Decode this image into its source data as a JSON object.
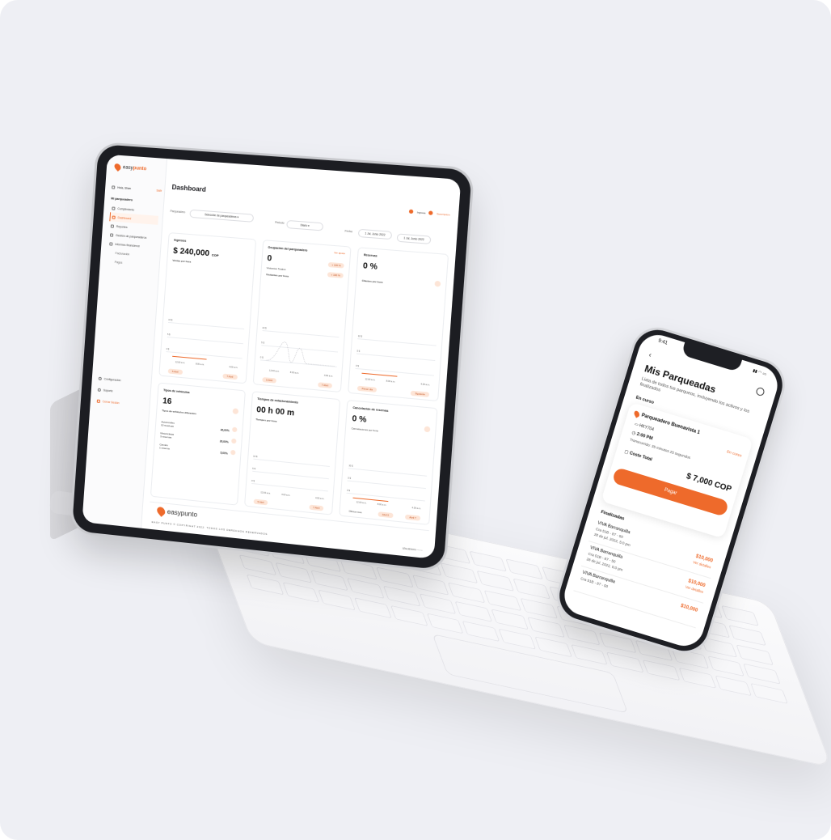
{
  "brand": {
    "name_prefix": "easy",
    "name_suffix": "punto",
    "accent": "#ee6a2b",
    "accent_soft": "#fde5d7"
  },
  "dashboard": {
    "title": "Dashboard",
    "user": {
      "greeting": "Hola, Shan",
      "logout_short": "Salir"
    },
    "sidebar": {
      "section": "Mi parqueadero",
      "items": [
        {
          "label": "Cumplimiento",
          "icon": "checklist-icon"
        },
        {
          "label": "Dashboard",
          "icon": "dashboard-icon"
        },
        {
          "label": "Reportes",
          "icon": "report-icon"
        },
        {
          "label": "Gestión de parqueaderos",
          "icon": "parking-icon"
        },
        {
          "label": "Informes financieros",
          "icon": "finance-icon"
        },
        {
          "label": "Facturación",
          "icon": ""
        },
        {
          "label": "Pagos",
          "icon": ""
        }
      ],
      "bottom": [
        {
          "label": "Configuración",
          "icon": "gear-icon"
        },
        {
          "label": "Soporte",
          "icon": "support-icon"
        },
        {
          "label": "Cerrar Sesión",
          "icon": "logout-icon"
        }
      ]
    },
    "topbar": {
      "account_label": "Ingresa",
      "account_value": "Suscripción"
    },
    "filters": {
      "parking_label": "Parqueadero",
      "parking_value": "Selección de parqueaderos",
      "period_label": "Periodo",
      "period_value": "Diario",
      "date_label": "Fecha",
      "date_from": "1 Jul, Junio 2022",
      "date_to": "1 Jul, Junio 2022"
    },
    "cards": [
      {
        "title": "Ingresos",
        "value": "$ 240,000",
        "unit": "COP",
        "subtitle": "Ventas por hora",
        "y_ticks": [
          "10 $",
          "5 $",
          "0 $"
        ],
        "x_ticks": [
          "12:00 a.m.",
          "8:00 a.m.",
          "4:00 a.m."
        ],
        "dates": [
          "5 Abril",
          "7 Abril"
        ]
      },
      {
        "title": "Ocupación del parqueadero",
        "value": "0",
        "link": "Ver ajuste",
        "rows": [
          "Visitantes Totales",
          "Visitantes por hora"
        ],
        "pills": [
          "+ 100 %",
          "+ 100 %"
        ],
        "y_ticks": [
          "10 $",
          "5 $",
          "0 $"
        ],
        "x_ticks": [
          "12:00 a.m.",
          "8:00 a.m.",
          "4:00 a.m."
        ],
        "dates": [
          "5 Abril",
          "7 Abril"
        ]
      },
      {
        "title": "Reservas",
        "value": "0 %",
        "subtitle": "Clientes por hora",
        "y_ticks": [
          "10 $",
          "5 $",
          "0 $"
        ],
        "x_ticks": [
          "12:00 a.m.",
          "8:00 a.m.",
          "4:00 a.m."
        ],
        "dates": [
          "Primer día",
          "Siguiente"
        ]
      },
      {
        "title": "Tipos de vehículos",
        "value": "16",
        "subtitle": "Tipos de vehículos diferentes",
        "items": [
          {
            "name": "Automóviles",
            "count": "10 reservas",
            "pct": "40,00%"
          },
          {
            "name": "Motocicletas",
            "count": "3 reservas",
            "pct": "30,00%"
          },
          {
            "name": "Camión",
            "count": "1 reserva",
            "pct": "5,00%"
          }
        ]
      },
      {
        "title": "Tiempos de estacionamiento",
        "value": "00 h 00 m",
        "subtitle": "Tiempos por hora",
        "y_ticks": [
          "10 $",
          "5 $",
          "0 $"
        ],
        "x_ticks": [
          "12:00 a.m.",
          "4:00 a.m.",
          "4:00 a.m."
        ],
        "dates": [
          "5 Abril",
          "7 Abril"
        ]
      },
      {
        "title": "Cancelación de reservas",
        "value": "0 %",
        "subtitle": "Cancelaciones por hora",
        "y_ticks": [
          "10 $",
          "5 $",
          "0 $"
        ],
        "x_ticks": [
          "12:00 a.m.",
          "8:00 a.m.",
          "4:00 a.m."
        ],
        "dates": [
          "Abril 5",
          "Abril 7"
        ],
        "footer_label": "Últimos mes"
      }
    ],
    "footer": {
      "logo_text": "easypunto",
      "copyright": "EASY PUNTO © COPYRIGHT 2022. TODOS LOS DERECHOS RESERVADOS",
      "social_label": "SÍGUENOS"
    }
  },
  "phone": {
    "time": "9:41",
    "title": "Mis Parqueadas",
    "description": "Lista de todos tus parqueos, incluyendo los activos y los finalizados",
    "in_progress_label": "En curso",
    "active": {
      "name": "Parqueadero Buenavista 1",
      "plate": "HKY704",
      "time": "2:00 PM",
      "elapsed": "Transcurrido: 35 minutos 25 segundos",
      "status": "En curso",
      "cost_label": "Coste Total",
      "cost": "$ 7,000 COP",
      "pay_button": "Pagar"
    },
    "finished_label": "Finalizadas",
    "finished": [
      {
        "name": "VIVA Barranquilla",
        "address": "Cra 51B - 87 - 50",
        "date": "28 de jul. 2022, 5:0 pm",
        "price": "$10,000",
        "status": "Ver detalles"
      },
      {
        "name": "VIVA Barranquilla",
        "address": "Cra 51B - 87 - 50",
        "date": "28 de jul. 2022, 5:0 pm",
        "price": "$10,000",
        "status": "Ver detalles"
      },
      {
        "name": "VIVA Barranquilla",
        "address": "Cra 51B - 87 - 50",
        "date": "",
        "price": "$10,000",
        "status": ""
      }
    ]
  }
}
